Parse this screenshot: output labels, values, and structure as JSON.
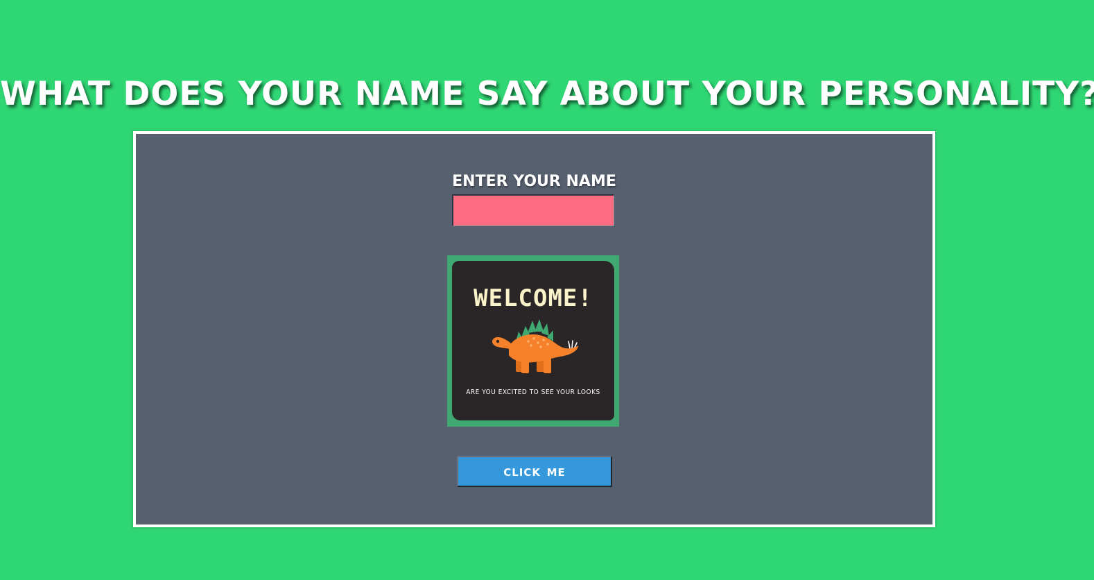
{
  "page": {
    "title": "What does your name say about your personality?"
  },
  "form": {
    "name_label": "Enter your name",
    "name_value": "",
    "name_placeholder": ""
  },
  "welcome_card": {
    "heading": "WELCOME!",
    "subtitle": "Are you excited to see your looks",
    "icon": "stegosaurus-dinosaur-icon"
  },
  "actions": {
    "button_label": "Click me"
  },
  "colors": {
    "page_background": "#2fd674",
    "panel_background": "#57606f",
    "input_background": "#ff6b81",
    "button_background": "#3498db",
    "card_background": "#2a2628",
    "card_border": "#3fa971",
    "dino_body": "#f5822a",
    "dino_plates": "#3fa971"
  }
}
